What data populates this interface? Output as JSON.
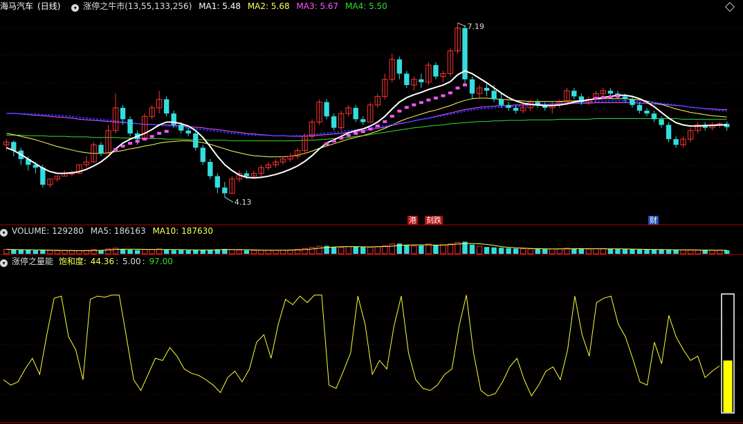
{
  "stock": {
    "name": "海马汽车",
    "period": "(日线)"
  },
  "main_indicator": {
    "name": "涨停之牛市(13,55,133,256)",
    "ma1": "MA1: 5.48",
    "ma2": "MA2: 5.68",
    "ma3": "MA3: 5.67",
    "ma4": "MA4: 5.50"
  },
  "annotations": {
    "high": "7.19",
    "low": "4.13"
  },
  "event_tags": [
    {
      "text": "港",
      "bg": "#b01010"
    },
    {
      "text": "刻跌",
      "bg": "#b01010"
    },
    {
      "text": "财",
      "bg": "#2050b0"
    }
  ],
  "volume_panel": {
    "vol": "VOLUME: 129280",
    "ma5": "MA5: 186163",
    "ma10": "MA10: 187630"
  },
  "energy_panel": {
    "name": "涨停之量能",
    "sat_label": "饱和度:",
    "v1": "44.36",
    "v2": "5.00",
    "v3": "97.00",
    "level_fraction": 0.44
  },
  "colors": {
    "up": "#ff3333",
    "down": "#33dddd",
    "ma1": "#ffffff",
    "ma2": "#ffff55",
    "ma3": "#ff55ff",
    "ma4": "#33dd33",
    "ma5": "#2233ff",
    "energy": "#ffff33",
    "bar": "#ffff00"
  },
  "chart_data": {
    "type": "candlestick",
    "price_ylim": [
      3.95,
      7.35
    ],
    "candles": [
      [
        5.05,
        5.15,
        4.95,
        5.1
      ],
      [
        5.1,
        5.12,
        4.85,
        4.95
      ],
      [
        4.95,
        5.0,
        4.7,
        4.8
      ],
      [
        4.8,
        4.85,
        4.6,
        4.7
      ],
      [
        4.7,
        4.75,
        4.55,
        4.65
      ],
      [
        4.65,
        4.7,
        4.3,
        4.35
      ],
      [
        4.35,
        4.45,
        4.3,
        4.45
      ],
      [
        4.45,
        4.5,
        4.4,
        4.5
      ],
      [
        4.5,
        4.6,
        4.5,
        4.55
      ],
      [
        4.55,
        4.6,
        4.5,
        4.55
      ],
      [
        4.55,
        4.7,
        4.55,
        4.7
      ],
      [
        4.7,
        4.85,
        4.65,
        4.75
      ],
      [
        4.75,
        5.1,
        4.75,
        5.05
      ],
      [
        5.05,
        5.1,
        4.85,
        4.9
      ],
      [
        4.9,
        5.4,
        4.9,
        5.3
      ],
      [
        5.3,
        5.95,
        5.25,
        5.7
      ],
      [
        5.7,
        5.75,
        5.4,
        5.5
      ],
      [
        5.5,
        5.55,
        5.2,
        5.25
      ],
      [
        5.25,
        5.3,
        5.05,
        5.15
      ],
      [
        5.15,
        5.6,
        5.15,
        5.55
      ],
      [
        5.55,
        5.75,
        5.5,
        5.7
      ],
      [
        5.7,
        6.0,
        5.6,
        5.85
      ],
      [
        5.85,
        5.9,
        5.55,
        5.6
      ],
      [
        5.6,
        5.65,
        5.35,
        5.4
      ],
      [
        5.4,
        5.45,
        5.25,
        5.3
      ],
      [
        5.3,
        5.35,
        5.2,
        5.25
      ],
      [
        5.25,
        5.3,
        4.95,
        5.0
      ],
      [
        5.0,
        5.05,
        4.7,
        4.75
      ],
      [
        4.75,
        4.8,
        4.45,
        4.5
      ],
      [
        4.5,
        4.55,
        4.2,
        4.3
      ],
      [
        4.3,
        4.4,
        4.13,
        4.2
      ],
      [
        4.2,
        4.5,
        4.2,
        4.45
      ],
      [
        4.45,
        4.6,
        4.4,
        4.55
      ],
      [
        4.55,
        4.6,
        4.45,
        4.5
      ],
      [
        4.5,
        4.6,
        4.45,
        4.55
      ],
      [
        4.55,
        4.7,
        4.5,
        4.65
      ],
      [
        4.65,
        4.75,
        4.6,
        4.7
      ],
      [
        4.7,
        4.8,
        4.65,
        4.75
      ],
      [
        4.75,
        4.85,
        4.7,
        4.8
      ],
      [
        4.8,
        4.9,
        4.75,
        4.85
      ],
      [
        4.85,
        5.0,
        4.8,
        4.95
      ],
      [
        4.95,
        5.25,
        4.9,
        5.2
      ],
      [
        5.2,
        5.5,
        5.15,
        5.45
      ],
      [
        5.45,
        5.85,
        5.4,
        5.8
      ],
      [
        5.8,
        5.85,
        5.5,
        5.55
      ],
      [
        5.55,
        5.6,
        5.3,
        5.35
      ],
      [
        5.35,
        5.65,
        5.3,
        5.6
      ],
      [
        5.6,
        5.75,
        5.55,
        5.7
      ],
      [
        5.7,
        5.75,
        5.45,
        5.5
      ],
      [
        5.5,
        5.55,
        5.4,
        5.45
      ],
      [
        5.45,
        5.8,
        5.45,
        5.75
      ],
      [
        5.75,
        5.95,
        5.7,
        5.9
      ],
      [
        5.9,
        6.3,
        5.85,
        6.2
      ],
      [
        6.2,
        6.65,
        6.15,
        6.55
      ],
      [
        6.55,
        6.6,
        6.2,
        6.3
      ],
      [
        6.3,
        6.35,
        6.05,
        6.1
      ],
      [
        6.1,
        6.25,
        6.0,
        6.2
      ],
      [
        6.2,
        6.3,
        6.05,
        6.15
      ],
      [
        6.15,
        6.5,
        6.1,
        6.45
      ],
      [
        6.45,
        6.5,
        6.2,
        6.25
      ],
      [
        6.25,
        6.35,
        6.15,
        6.3
      ],
      [
        6.3,
        6.75,
        6.25,
        6.7
      ],
      [
        6.7,
        7.19,
        6.65,
        7.1
      ],
      [
        7.1,
        7.15,
        6.1,
        6.2
      ],
      [
        6.2,
        6.25,
        5.85,
        5.95
      ],
      [
        5.95,
        6.1,
        5.85,
        6.05
      ],
      [
        6.05,
        6.15,
        5.9,
        6.0
      ],
      [
        6.0,
        6.1,
        5.8,
        5.85
      ],
      [
        5.85,
        5.95,
        5.7,
        5.75
      ],
      [
        5.75,
        5.8,
        5.65,
        5.7
      ],
      [
        5.7,
        5.75,
        5.6,
        5.65
      ],
      [
        5.65,
        5.75,
        5.6,
        5.7
      ],
      [
        5.7,
        5.85,
        5.65,
        5.8
      ],
      [
        5.8,
        5.85,
        5.7,
        5.75
      ],
      [
        5.75,
        5.8,
        5.65,
        5.7
      ],
      [
        5.7,
        5.8,
        5.6,
        5.75
      ],
      [
        5.75,
        5.85,
        5.7,
        5.8
      ],
      [
        5.8,
        6.05,
        5.75,
        6.0
      ],
      [
        6.0,
        6.05,
        5.85,
        5.9
      ],
      [
        5.9,
        5.95,
        5.75,
        5.8
      ],
      [
        5.8,
        5.9,
        5.75,
        5.85
      ],
      [
        5.85,
        6.0,
        5.8,
        5.95
      ],
      [
        5.95,
        6.05,
        5.9,
        6.0
      ],
      [
        6.0,
        6.05,
        5.9,
        5.95
      ],
      [
        5.95,
        6.0,
        5.85,
        5.9
      ],
      [
        5.9,
        5.95,
        5.8,
        5.85
      ],
      [
        5.85,
        5.9,
        5.7,
        5.75
      ],
      [
        5.75,
        5.8,
        5.6,
        5.65
      ],
      [
        5.65,
        5.7,
        5.55,
        5.6
      ],
      [
        5.6,
        5.65,
        5.45,
        5.5
      ],
      [
        5.5,
        5.55,
        5.35,
        5.4
      ],
      [
        5.4,
        5.45,
        5.1,
        5.15
      ],
      [
        5.15,
        5.2,
        5.0,
        5.05
      ],
      [
        5.05,
        5.2,
        5.0,
        5.15
      ],
      [
        5.15,
        5.35,
        5.1,
        5.3
      ],
      [
        5.3,
        5.45,
        5.25,
        5.4
      ],
      [
        5.4,
        5.45,
        5.3,
        5.35
      ],
      [
        5.35,
        5.45,
        5.3,
        5.4
      ],
      [
        5.4,
        5.45,
        5.35,
        5.42
      ],
      [
        5.42,
        5.46,
        5.3,
        5.36
      ]
    ],
    "ma1": [
      5.0,
      4.95,
      4.88,
      4.8,
      4.72,
      4.64,
      4.58,
      4.55,
      4.55,
      4.56,
      4.58,
      4.62,
      4.68,
      4.75,
      4.85,
      4.98,
      5.08,
      5.15,
      5.2,
      5.25,
      5.32,
      5.4,
      5.45,
      5.45,
      5.42,
      5.38,
      5.3,
      5.18,
      5.02,
      4.85,
      4.7,
      4.6,
      4.52,
      4.48,
      4.47,
      4.48,
      4.5,
      4.53,
      4.57,
      4.62,
      4.68,
      4.76,
      4.86,
      4.98,
      5.08,
      5.14,
      5.2,
      5.26,
      5.3,
      5.33,
      5.38,
      5.45,
      5.55,
      5.68,
      5.8,
      5.88,
      5.93,
      5.97,
      6.02,
      6.06,
      6.1,
      6.16,
      6.28,
      6.35,
      6.3,
      6.22,
      6.14,
      6.05,
      5.96,
      5.88,
      5.82,
      5.78,
      5.76,
      5.75,
      5.74,
      5.74,
      5.75,
      5.77,
      5.8,
      5.82,
      5.84,
      5.86,
      5.88,
      5.9,
      5.92,
      5.92,
      5.9,
      5.86,
      5.8,
      5.72,
      5.62,
      5.52,
      5.44,
      5.4,
      5.38,
      5.38,
      5.39,
      5.39,
      5.4,
      5.4
    ],
    "ma2": [
      5.25,
      5.23,
      5.2,
      5.17,
      5.14,
      5.1,
      5.06,
      5.02,
      4.99,
      4.96,
      4.93,
      4.91,
      4.9,
      4.9,
      4.91,
      4.93,
      4.95,
      4.98,
      5.0,
      5.03,
      5.05,
      5.08,
      5.1,
      5.11,
      5.12,
      5.12,
      5.11,
      5.09,
      5.06,
      5.02,
      4.98,
      4.94,
      4.91,
      4.88,
      4.86,
      4.85,
      4.84,
      4.84,
      4.84,
      4.85,
      4.87,
      4.9,
      4.94,
      4.99,
      5.03,
      5.07,
      5.11,
      5.15,
      5.18,
      5.21,
      5.25,
      5.29,
      5.34,
      5.4,
      5.46,
      5.51,
      5.55,
      5.59,
      5.63,
      5.66,
      5.7,
      5.74,
      5.79,
      5.83,
      5.86,
      5.87,
      5.87,
      5.86,
      5.85,
      5.84,
      5.83,
      5.82,
      5.81,
      5.81,
      5.81,
      5.81,
      5.81,
      5.82,
      5.82,
      5.83,
      5.84,
      5.85,
      5.86,
      5.86,
      5.86,
      5.86,
      5.85,
      5.84,
      5.82,
      5.79,
      5.76,
      5.72,
      5.68,
      5.65,
      5.62,
      5.6,
      5.58,
      5.56,
      5.55,
      5.54
    ],
    "ma3": [
      5.6,
      5.6,
      5.59,
      5.58,
      5.57,
      5.56,
      5.55,
      5.54,
      5.53,
      5.52,
      5.5,
      5.49,
      5.48,
      5.47,
      5.46,
      5.45,
      5.44,
      5.43,
      5.42,
      5.41,
      5.41,
      5.4,
      5.4,
      5.39,
      5.38,
      5.37,
      5.36,
      5.35,
      5.33,
      5.32,
      5.3,
      5.28,
      5.27,
      5.25,
      5.24,
      5.23,
      5.22,
      5.21,
      5.21,
      5.2,
      5.2,
      5.2,
      5.21,
      5.22,
      5.23,
      5.24,
      5.25,
      5.27,
      5.28,
      5.3,
      5.32,
      5.34,
      5.36,
      5.39,
      5.42,
      5.44,
      5.47,
      5.5,
      5.52,
      5.55,
      5.58,
      5.61,
      5.64,
      5.67,
      5.69,
      5.71,
      5.72,
      5.73,
      5.74,
      5.74,
      5.75,
      5.75,
      5.76,
      5.76,
      5.76,
      5.77,
      5.77,
      5.77,
      5.78,
      5.78,
      5.78,
      5.79,
      5.79,
      5.79,
      5.79,
      5.79,
      5.79,
      5.78,
      5.78,
      5.77,
      5.76,
      5.75,
      5.74,
      5.73,
      5.71,
      5.7,
      5.69,
      5.68,
      5.67,
      5.67
    ],
    "ma4": [
      5.22,
      5.22,
      5.22,
      5.21,
      5.21,
      5.21,
      5.2,
      5.2,
      5.2,
      5.19,
      5.19,
      5.19,
      5.18,
      5.18,
      5.18,
      5.18,
      5.17,
      5.17,
      5.17,
      5.16,
      5.16,
      5.16,
      5.15,
      5.15,
      5.15,
      5.14,
      5.14,
      5.14,
      5.13,
      5.13,
      5.13,
      5.12,
      5.12,
      5.12,
      5.12,
      5.12,
      5.12,
      5.12,
      5.12,
      5.12,
      5.12,
      5.13,
      5.13,
      5.14,
      5.15,
      5.16,
      5.17,
      5.18,
      5.2,
      5.21,
      5.23,
      5.25,
      5.27,
      5.29,
      5.31,
      5.33,
      5.35,
      5.36,
      5.38,
      5.39,
      5.4,
      5.42,
      5.43,
      5.44,
      5.45,
      5.46,
      5.46,
      5.47,
      5.47,
      5.48,
      5.48,
      5.48,
      5.49,
      5.49,
      5.49,
      5.49,
      5.5,
      5.5,
      5.5,
      5.5,
      5.5,
      5.51,
      5.51,
      5.51,
      5.51,
      5.51,
      5.51,
      5.51,
      5.51,
      5.51,
      5.51,
      5.51,
      5.51,
      5.5,
      5.5,
      5.5,
      5.5,
      5.5,
      5.5,
      5.5
    ],
    "volume": [
      120,
      110,
      100,
      100,
      90,
      110,
      90,
      80,
      85,
      80,
      85,
      90,
      110,
      100,
      130,
      150,
      120,
      110,
      100,
      115,
      120,
      130,
      110,
      100,
      100,
      95,
      110,
      105,
      100,
      120,
      130,
      110,
      100,
      95,
      90,
      95,
      100,
      95,
      100,
      105,
      120,
      140,
      170,
      200,
      210,
      180,
      170,
      190,
      200,
      180,
      175,
      190,
      210,
      260,
      270,
      230,
      210,
      220,
      260,
      230,
      240,
      260,
      300,
      320,
      240,
      200,
      180,
      170,
      160,
      150,
      140,
      135,
      130,
      128,
      125,
      130,
      135,
      150,
      140,
      130,
      125,
      135,
      140,
      130,
      125,
      120,
      118,
      115,
      112,
      110,
      108,
      105,
      104,
      102,
      100,
      98,
      96,
      95,
      94,
      93
    ],
    "vol_ylim": [
      0,
      420
    ],
    "energy": [
      20,
      15,
      18,
      30,
      40,
      25,
      62,
      96,
      98,
      60,
      48,
      20,
      95,
      98,
      97,
      99,
      99,
      60,
      20,
      10,
      25,
      40,
      38,
      50,
      42,
      30,
      26,
      24,
      20,
      15,
      8,
      22,
      28,
      18,
      30,
      55,
      62,
      40,
      72,
      95,
      90,
      98,
      92,
      99,
      99,
      15,
      12,
      28,
      45,
      98,
      72,
      25,
      38,
      30,
      70,
      98,
      45,
      20,
      12,
      10,
      15,
      25,
      30,
      70,
      99,
      45,
      10,
      5,
      7,
      18,
      32,
      40,
      20,
      5,
      15,
      28,
      32,
      20,
      48,
      98,
      62,
      42,
      92,
      96,
      98,
      72,
      60,
      40,
      18,
      15,
      55,
      35,
      80,
      60,
      48,
      38,
      42,
      22,
      28,
      33
    ],
    "energy_ylim": [
      0,
      100
    ]
  }
}
